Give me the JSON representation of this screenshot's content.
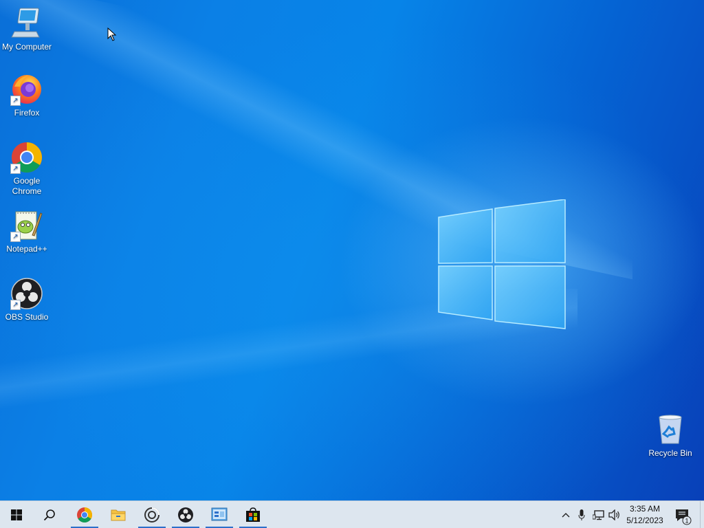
{
  "desktop": {
    "icons": [
      {
        "label": "My Computer",
        "icon": "computer-icon"
      },
      {
        "label": "Firefox",
        "icon": "firefox-icon"
      },
      {
        "label": "Google Chrome",
        "icon": "chrome-icon"
      },
      {
        "label": "Notepad++",
        "icon": "notepadpp-icon"
      },
      {
        "label": "OBS Studio",
        "icon": "obs-icon"
      },
      {
        "label": "Recycle Bin",
        "icon": "recycle-bin-icon"
      }
    ],
    "background_colors": [
      "#0a6fd8",
      "#0784e8",
      "#0840b8"
    ]
  },
  "taskbar": {
    "start": "windows-start-icon",
    "search": "search-icon",
    "apps": [
      {
        "name": "Google Chrome",
        "icon": "chrome-icon",
        "running": true
      },
      {
        "name": "File Explorer",
        "icon": "folder-icon",
        "running": false
      },
      {
        "name": "Media Player",
        "icon": "media-player-icon",
        "running": true
      },
      {
        "name": "OBS Studio",
        "icon": "obs-icon",
        "running": true
      },
      {
        "name": "Control Panel",
        "icon": "control-panel-icon",
        "running": true
      },
      {
        "name": "Microsoft Store",
        "icon": "store-icon",
        "running": true
      }
    ],
    "tray": {
      "icons": [
        "chevron-up-icon",
        "microphone-icon",
        "network-icon",
        "volume-icon"
      ],
      "time": "3:35 AM",
      "date": "5/12/2023",
      "notification_count": "1"
    },
    "accent": "#2c6fca"
  }
}
